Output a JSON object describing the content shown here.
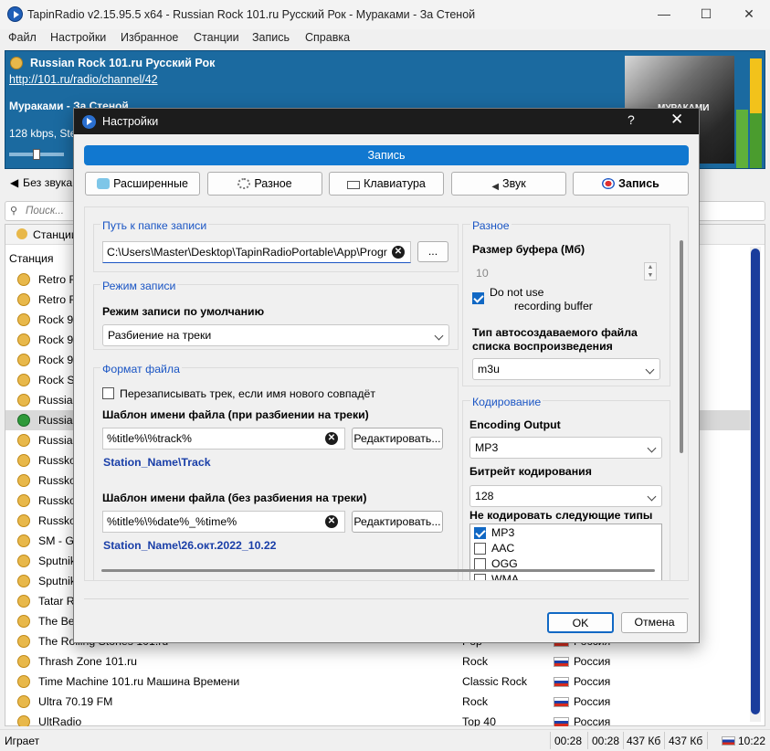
{
  "window": {
    "title": "TapinRadio v2.15.95.5 x64  -  Russian Rock 101.ru Русский Рок - Мураками - За Стеной",
    "minimize": "—",
    "maximize": "☐",
    "close": "✕"
  },
  "menu": [
    "Файл",
    "Настройки",
    "Избранное",
    "Станции",
    "Запись",
    "Справка"
  ],
  "player": {
    "station": "Russian Rock 101.ru Русский Рок",
    "url": "http://101.ru/radio/channel/42",
    "track": "Мураками - За Стеной",
    "info": "128 kbps, Ste",
    "cover_text": "МУРАКАМИ",
    "volume_level": 0.5
  },
  "toolbar": {
    "mute_label": "Без звука"
  },
  "search": {
    "placeholder": "Поиск..."
  },
  "list": {
    "tab_label": "Станции",
    "header": "Станция",
    "rows": [
      {
        "name": "Retro F",
        "genre": "",
        "country": ""
      },
      {
        "name": "Retro F",
        "genre": "",
        "country": ""
      },
      {
        "name": "Rock 9",
        "genre": "",
        "country": ""
      },
      {
        "name": "Rock 9",
        "genre": "",
        "country": ""
      },
      {
        "name": "Rock 9",
        "genre": "",
        "country": ""
      },
      {
        "name": "Rock S",
        "genre": "",
        "country": ""
      },
      {
        "name": "Russia",
        "genre": "",
        "country": ""
      },
      {
        "name": "Russia",
        "genre": "",
        "country": ""
      },
      {
        "name": "Russia",
        "genre": "",
        "country": ""
      },
      {
        "name": "Russko",
        "genre": "",
        "country": ""
      },
      {
        "name": "Russko",
        "genre": "",
        "country": ""
      },
      {
        "name": "Russko",
        "genre": "",
        "country": ""
      },
      {
        "name": "Russko",
        "genre": "",
        "country": ""
      },
      {
        "name": "SM - Go",
        "genre": "",
        "country": ""
      },
      {
        "name": "Sputnik",
        "genre": "",
        "country": ""
      },
      {
        "name": "Sputnik",
        "genre": "",
        "country": ""
      },
      {
        "name": "Tatar R",
        "genre": "",
        "country": ""
      },
      {
        "name": "The Be",
        "genre": "",
        "country": ""
      },
      {
        "name": "The Rolling Stones 101.ru",
        "genre": "Pop",
        "country": "Россия"
      },
      {
        "name": "Thrash Zone 101.ru",
        "genre": "Rock",
        "country": "Россия"
      },
      {
        "name": "Time Machine 101.ru Машина Времени",
        "genre": "Classic Rock",
        "country": "Россия"
      },
      {
        "name": "Ultra 70.19 FM",
        "genre": "Rock",
        "country": "Россия"
      },
      {
        "name": "UltRadio",
        "genre": "Top 40",
        "country": "Россия"
      }
    ]
  },
  "status": {
    "state": "Играет",
    "t1": "00:28",
    "t2": "00:28",
    "s1": "437 Кб",
    "s2": "437 Кб",
    "clock": "10:22"
  },
  "dialog": {
    "title": "Настройки",
    "help": "?",
    "close": "✕",
    "banner": "Запись",
    "tabs": [
      "Расширенные",
      "Разное",
      "Клавиатура",
      "Звук",
      "Запись"
    ],
    "folder": {
      "title": "Путь к папке записи",
      "value": "C:\\Users\\Master\\Desktop\\TapinRadioPortable\\App\\Progr",
      "browse": "..."
    },
    "mode": {
      "title": "Режим записи",
      "label": "Режим записи по умолчанию",
      "value": "Разбиение на треки"
    },
    "format": {
      "title": "Формат файла",
      "overwrite_label": "Перезаписывать трек, если имя нового совпадёт",
      "overwrite_checked": false,
      "split_label": "Шаблон имени файла (при разбиении на треки)",
      "split_value": "%title%\\%track%",
      "split_edit": "Редактировать...",
      "split_preview": "Station_Name\\Track",
      "nosplit_label": "Шаблон имени файла (без разбиения на треки)",
      "nosplit_value": "%title%\\%date%_%time%",
      "nosplit_edit": "Редактировать...",
      "nosplit_preview": "Station_Name\\26.окт.2022_10.22"
    },
    "misc": {
      "title": "Разное",
      "buffer_label": "Размер буфера (Мб)",
      "buffer_value": "10",
      "nobuffer_label_1": "Do not use",
      "nobuffer_label_2": "recording buffer",
      "nobuffer_checked": true,
      "playlist_label_1": "Тип автосоздаваемого файла",
      "playlist_label_2": "списка воспроизведения",
      "playlist_value": "m3u"
    },
    "encoding": {
      "title": "Кодирование",
      "output_label": "Encoding Output",
      "output_value": "MP3",
      "bitrate_label": "Битрейт кодирования",
      "bitrate_value": "128",
      "exclude_label": "Не кодировать следующие типы",
      "types": [
        {
          "name": "MP3",
          "checked": true
        },
        {
          "name": "AAC",
          "checked": false
        },
        {
          "name": "OGG",
          "checked": false
        },
        {
          "name": "WMA",
          "checked": false
        }
      ]
    },
    "ok": "OK",
    "cancel": "Отмена"
  },
  "colors": {
    "accent": "#1178d0",
    "player_bg": "#1b6aa0",
    "link": "#1a3fa8",
    "group_title": "#1a55c4"
  }
}
